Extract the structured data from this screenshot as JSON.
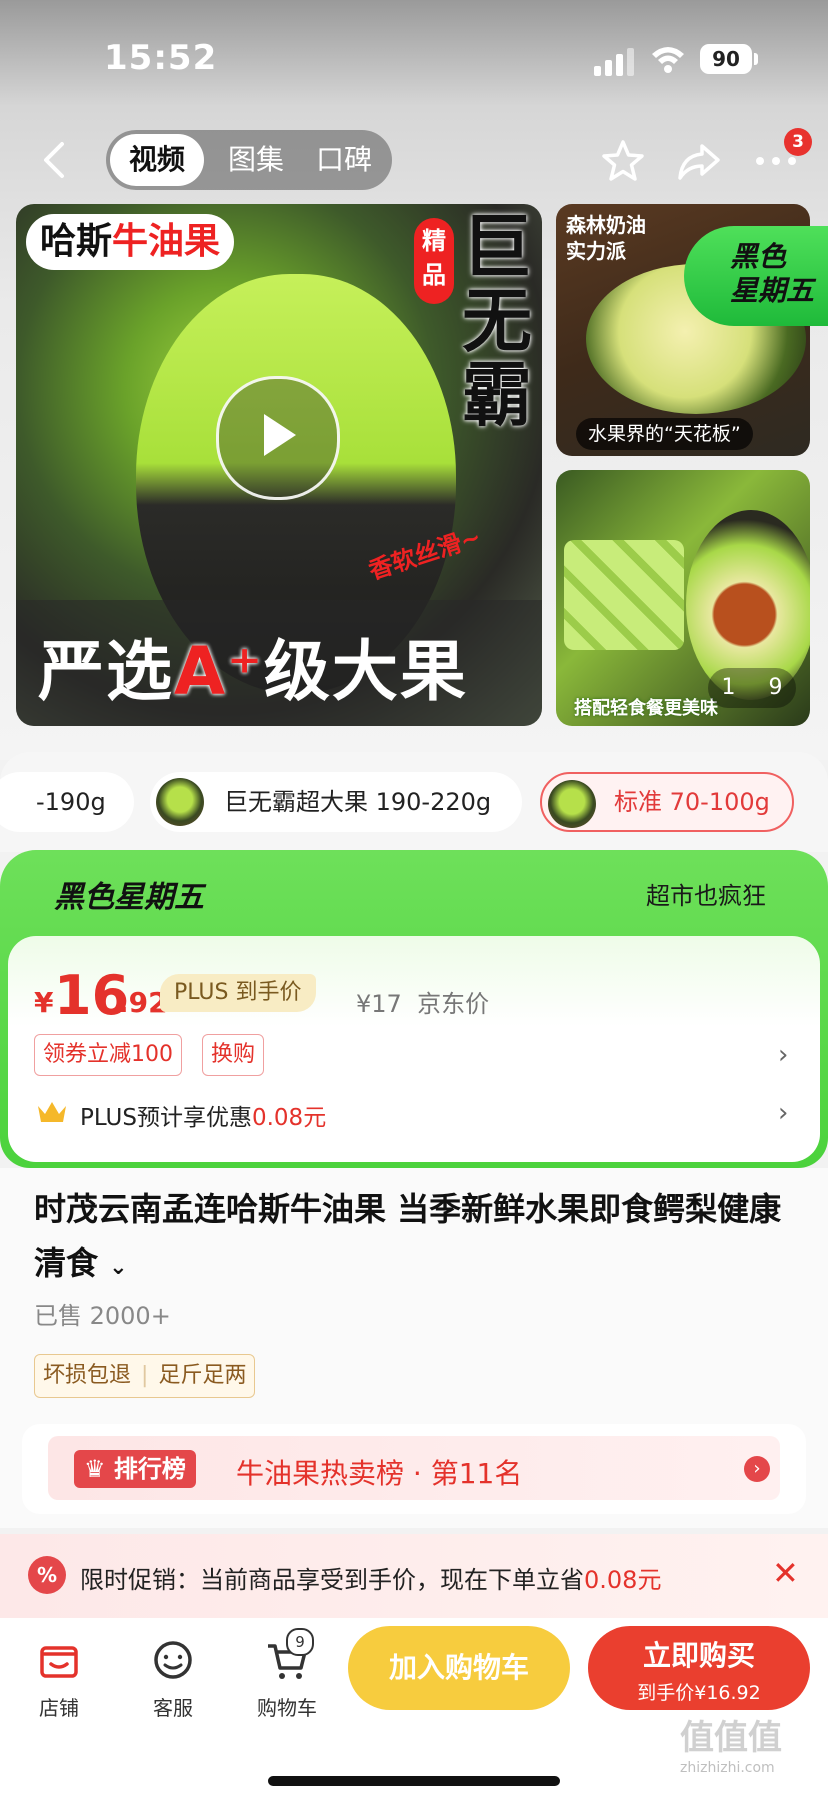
{
  "status_bar": {
    "time": "15:52",
    "battery": "90"
  },
  "nav": {
    "tabs": [
      {
        "label": "视频"
      },
      {
        "label": "图集"
      },
      {
        "label": "口碑"
      }
    ],
    "more_badge": "3"
  },
  "media": {
    "main": {
      "tag_black": "哈斯",
      "tag_red": "牛油果",
      "jingpin": "精品",
      "headline": "巨无霸",
      "script_text": "香软丝滑~",
      "bottom_prefix": "严选",
      "bottom_grade": "A⁺",
      "bottom_suffix": "级大果"
    },
    "thumb1": {
      "title": "森林奶油\n实力派",
      "caption": "水果界的“天花板”"
    },
    "black_friday_badge": "黑色\n星期五",
    "thumb2": {
      "caption": "搭配轻食餐更美味"
    },
    "page_indicator": {
      "current": "1",
      "total": "9"
    }
  },
  "variants": [
    {
      "label": "-190g"
    },
    {
      "label": "巨无霸超大果 190-220g"
    },
    {
      "label": "标准 70-100g",
      "selected": true
    }
  ],
  "promo": {
    "title": "黑色星期五",
    "slogan": "超市也疯狂",
    "price_symbol": "¥",
    "price_int": "16",
    "price_dec": ".92",
    "plus_tag": "PLUS 到手价",
    "jd_price": "¥17  京东价",
    "coupons": [
      "领券立减100",
      "换购"
    ],
    "plus_save_prefix": "PLUS预计享优惠",
    "plus_save_value": "0.08元"
  },
  "product": {
    "title": "时茂云南孟连哈斯牛油果 当季新鲜水果即食鳄梨健康清食",
    "sold": "已售 2000+",
    "tags": [
      "坏损包退",
      "足斤足两"
    ],
    "rank_label": "排行榜",
    "rank_text": "牛油果热卖榜 · 第11名"
  },
  "flash_promo": {
    "icon": "%",
    "text": "限时促销：当前商品享受到手价，现在下单立省",
    "value": "0.08元"
  },
  "bottom_bar": {
    "store": "店铺",
    "service": "客服",
    "cart": "购物车",
    "cart_badge": "9",
    "add_cart": "加入购物车",
    "buy_now": "立即购买",
    "buy_now_sub": "到手价¥16.92"
  },
  "watermark": {
    "text": "值值值",
    "sub": "zhizhizhi.com"
  },
  "colors": {
    "accent_red": "#e4322b",
    "promo_green": "#4bd23c",
    "add_cart_yellow": "#f7cc3e"
  }
}
